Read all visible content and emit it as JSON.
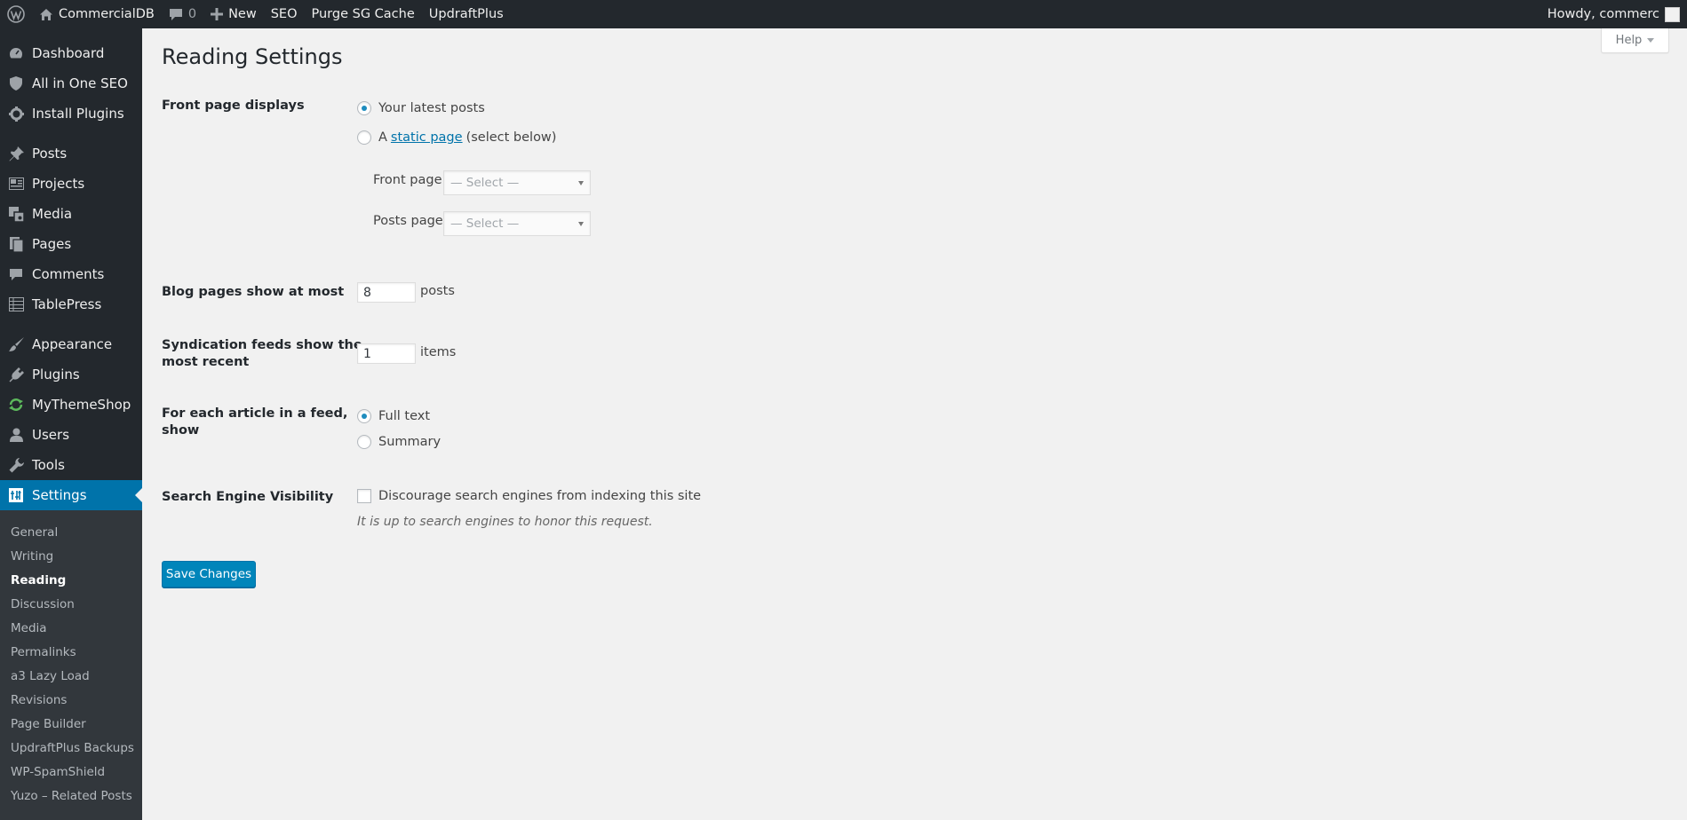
{
  "adminbar": {
    "site_name": "CommercialDB",
    "comments_count": "0",
    "new_label": "New",
    "seo_label": "SEO",
    "purge_label": "Purge SG Cache",
    "updraft_label": "UpdraftPlus",
    "howdy": "Howdy, commerc"
  },
  "menu": {
    "items": [
      {
        "label": "Dashboard",
        "icon": "dashboard-icon"
      },
      {
        "label": "All in One SEO",
        "icon": "shield-icon"
      },
      {
        "label": "Install Plugins",
        "icon": "gear-icon"
      },
      {
        "label": "Posts",
        "icon": "pushpin-icon"
      },
      {
        "label": "Projects",
        "icon": "portfolio-icon"
      },
      {
        "label": "Media",
        "icon": "media-icon"
      },
      {
        "label": "Pages",
        "icon": "pages-icon"
      },
      {
        "label": "Comments",
        "icon": "comment-icon"
      },
      {
        "label": "TablePress",
        "icon": "table-icon"
      },
      {
        "label": "Appearance",
        "icon": "paintbrush-icon"
      },
      {
        "label": "Plugins",
        "icon": "plugin-icon"
      },
      {
        "label": "MyThemeShop",
        "icon": "refresh-icon"
      },
      {
        "label": "Users",
        "icon": "user-icon"
      },
      {
        "label": "Tools",
        "icon": "wrench-icon"
      },
      {
        "label": "Settings",
        "icon": "settings-icon"
      }
    ],
    "submenu": [
      "General",
      "Writing",
      "Reading",
      "Discussion",
      "Media",
      "Permalinks",
      "a3 Lazy Load",
      "Revisions",
      "Page Builder",
      "UpdraftPlus Backups",
      "WP-SpamShield",
      "Yuzo – Related Posts"
    ]
  },
  "page": {
    "title": "Reading Settings",
    "help_label": "Help",
    "front_page_displays": {
      "label": "Front page displays",
      "option_latest": "Your latest posts",
      "option_static_prefix": "A",
      "option_static_link": "static page",
      "option_static_suffix": "(select below)",
      "front_page_label": "Front page:",
      "front_page_value": "— Select —",
      "posts_page_label": "Posts page:",
      "posts_page_value": "— Select —"
    },
    "blog_pages": {
      "label": "Blog pages show at most",
      "value": "8",
      "suffix": "posts"
    },
    "syndication": {
      "label_line1": "Syndication feeds show the",
      "label_line2": "most recent",
      "value": "1",
      "suffix": "items"
    },
    "feed_article": {
      "label_line1": "For each article in a feed,",
      "label_line2": "show",
      "option_full": "Full text",
      "option_summary": "Summary"
    },
    "search_visibility": {
      "label": "Search Engine Visibility",
      "checkbox_label": "Discourage search engines from indexing this site",
      "description": "It is up to search engines to honor this request."
    },
    "save_label": "Save Changes"
  }
}
